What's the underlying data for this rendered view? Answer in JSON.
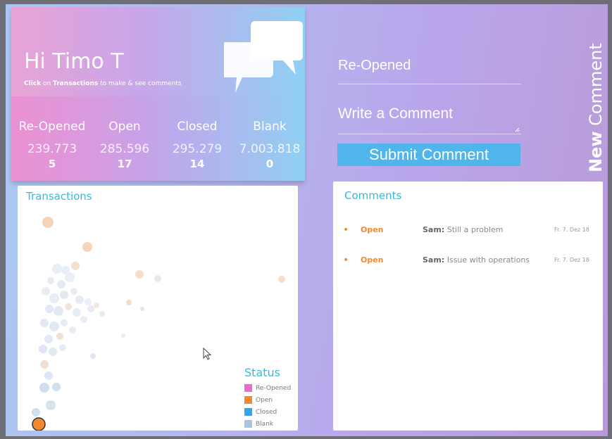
{
  "greeting": {
    "title": "Hi Timo T",
    "hint_click": "Click",
    "hint_on": " on ",
    "hint_transactions": "Transactions",
    "hint_rest": " to make & see comments"
  },
  "stats": [
    {
      "label": "Re-Opened",
      "value": "239.773",
      "count": "5"
    },
    {
      "label": "Open",
      "value": "285.596",
      "count": "17"
    },
    {
      "label": "Closed",
      "value": "295.279",
      "count": "14"
    },
    {
      "label": "Blank",
      "value": "7.003.818",
      "count": "0"
    }
  ],
  "transactions": {
    "title": "Transactions",
    "legend_title": "Status",
    "legend": [
      {
        "label": "Re-Opened",
        "color": "#e46fc8"
      },
      {
        "label": "Open",
        "color": "#f28a2d"
      },
      {
        "label": "Closed",
        "color": "#3aa3e8"
      },
      {
        "label": "Blank",
        "color": "#a7c4e4"
      }
    ]
  },
  "form": {
    "status_select": "Re-Opened",
    "comment_placeholder": "Write a Comment",
    "submit_label": "Submit Comment",
    "side_title_bold": "New",
    "side_title_rest": " Comment"
  },
  "comments": {
    "title": "Comments",
    "items": [
      {
        "status": "Open",
        "author": "Sam:",
        "text": " Still a problem",
        "date": "Fr. 7. Dez 18"
      },
      {
        "status": "Open",
        "author": "Sam:",
        "text": " Issue with operations",
        "date": "Fr. 7. Dez 18"
      }
    ]
  },
  "colors": {
    "accent": "#3bb8d8",
    "open": "#f28a2d",
    "submit": "#4fb5ea"
  }
}
